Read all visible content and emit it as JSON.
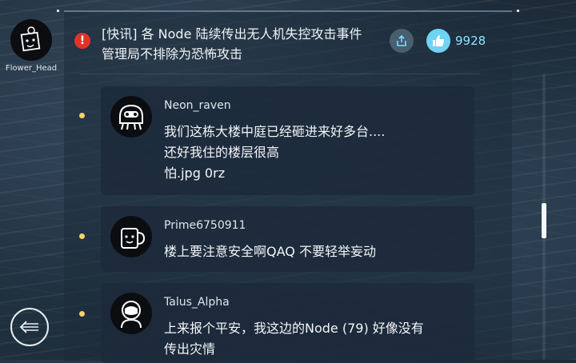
{
  "user": {
    "name": "Flower_Head"
  },
  "news": {
    "headline": "[快讯] 各 Node 陆续传出无人机失控攻击事件\n管理局不排除为恐怖攻击",
    "like_count": "9928"
  },
  "comments": [
    {
      "author": "Neon_raven",
      "text": "我们这栋大楼中庭已经砸进来好多台....\n还好我住的楼层很高\n怕.jpg 0rz"
    },
    {
      "author": "Prime6750911",
      "text": "楼上要注意安全啊QAQ 不要轻举妄动"
    },
    {
      "author": "Talus_Alpha",
      "text": "上来报个平安，我这边的Node (79) 好像没有\n传出灾情"
    }
  ],
  "colors": {
    "accent": "#6fd3f2",
    "alert": "#e0332b",
    "bullet": "#f2d46a"
  },
  "icons": {
    "alert": "exclamation-icon",
    "share": "share-icon",
    "like": "thumbs-up-icon",
    "back": "back-arrow-icon"
  }
}
